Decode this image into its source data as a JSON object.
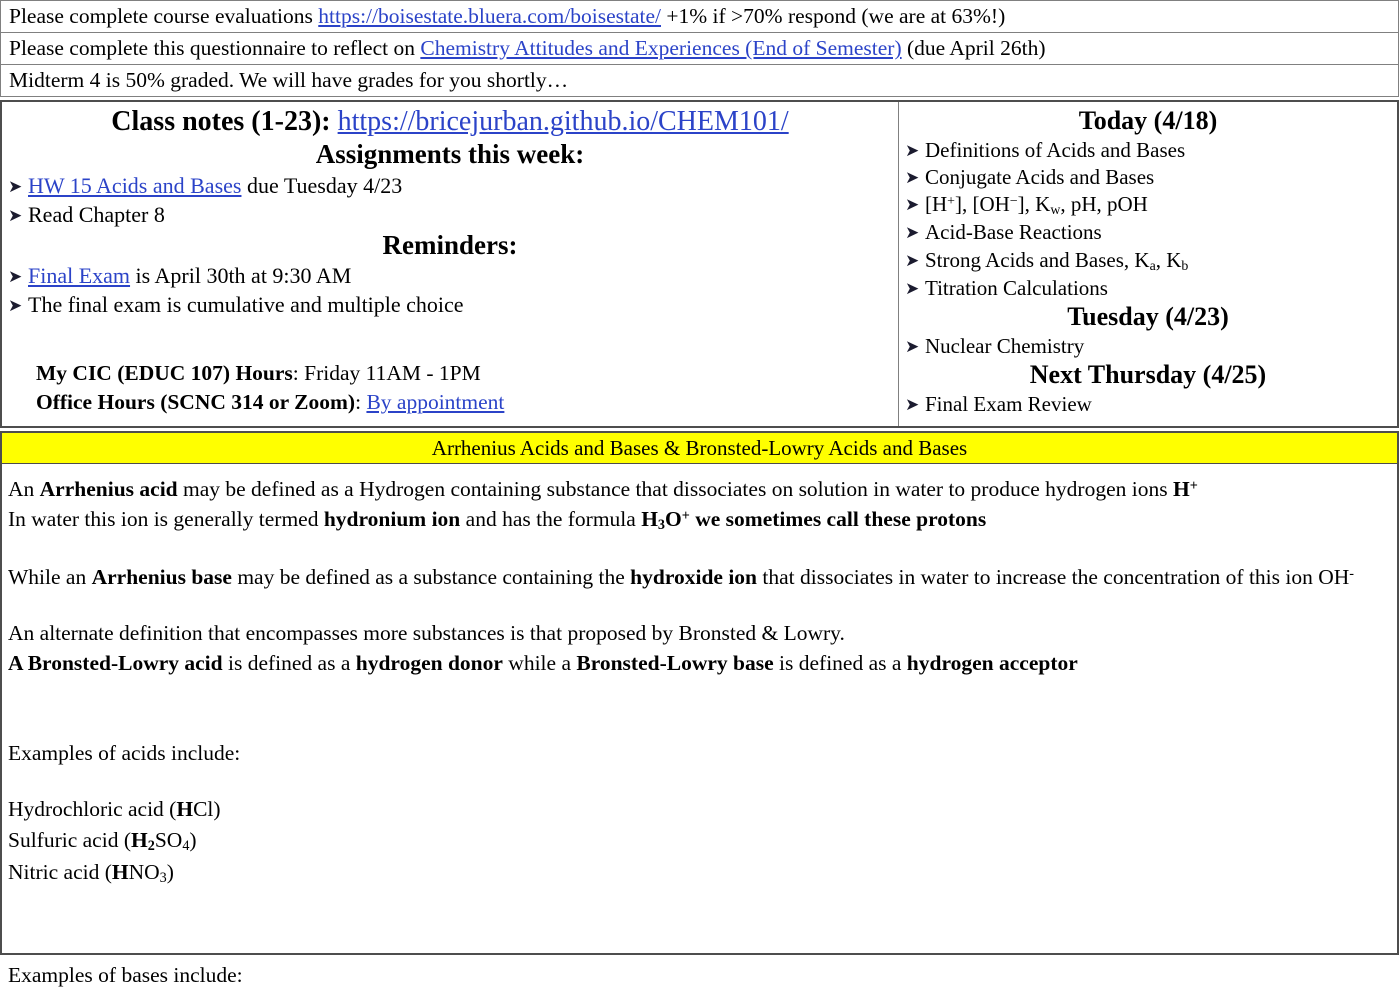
{
  "announcements": [
    {
      "pre": "Please complete course evaluations ",
      "link": "https://boisestate.bluera.com/boisestate/",
      "post": " +1% if >70% respond (we are at 63%!)"
    },
    {
      "pre": "Please complete this questionnaire to reflect on ",
      "link": "Chemistry Attitudes and Experiences (End of Semester)",
      "post": " (due April 26th)"
    },
    {
      "pre": "Midterm 4 is 50% graded. We will have grades for you shortly…",
      "link": "",
      "post": ""
    }
  ],
  "board": {
    "class_notes_label": "Class notes (1-23):",
    "class_notes_url": "https://bricejurban.github.io/CHEM101/",
    "assignments_header": "Assignments this week:",
    "assignments": [
      {
        "link": "HW 15 Acids and Bases",
        "text": " due Tuesday 4/23"
      },
      {
        "link": "",
        "text": "Read Chapter 8"
      }
    ],
    "reminders_header": "Reminders:",
    "reminders": [
      {
        "link": "Final Exam",
        "text": " is April 30th at 9:30 AM"
      },
      {
        "link": "",
        "text": "The final exam is cumulative and multiple choice"
      }
    ],
    "cic_label": "My CIC (EDUC 107) Hours",
    "cic_value": ": Friday 11AM - 1PM",
    "office_label": "Office Hours (SCNC 314 or Zoom)",
    "office_sep": ": ",
    "office_link": "By appointment"
  },
  "agenda": {
    "today_header": "Today (4/18)",
    "today_items": [
      "Definitions of Acids and Bases",
      "Conjugate Acids and Bases",
      "[H+], [OH−], Kw, pH, pOH",
      "Acid-Base Reactions",
      "Strong Acids and Bases, Ka, Kb",
      "Titration Calculations"
    ],
    "tuesday_header": "Tuesday (4/23)",
    "tuesday_items": [
      "Nuclear Chemistry"
    ],
    "thursday_header": "Next Thursday (4/25)",
    "thursday_items": [
      "Final Exam Review"
    ]
  },
  "slide": {
    "banner_title": "Arrhenius Acids and Bases & Bronsted-Lowry Acids and Bases",
    "line1_a": "An ",
    "line1_b": "Arrhenius acid",
    "line1_c": " may be defined as a Hydrogen containing substance that dissociates on solution in water to produce hydrogen ions ",
    "line1_d": "H+",
    "line2_a": "In water this ion is generally termed ",
    "line2_b": "hydronium ion",
    "line2_c": " and has the formula ",
    "line2_d": "H3O+ we sometimes call these protons",
    "line3_a": "While an ",
    "line3_b": "Arrhenius base",
    "line3_c": " may be defined as a substance containing the ",
    "line3_d": "hydroxide ion",
    "line3_e": " that dissociates in water to increase the concentration of this ion OH-",
    "line4": "An alternate definition that encompasses more substances is that proposed by Bronsted & Lowry.",
    "line5_a": "A Bronsted-Lowry acid",
    "line5_b": " is defined as a ",
    "line5_c": "hydrogen donor",
    "line5_d": " while a ",
    "line5_e": "Bronsted-Lowry base",
    "line5_f": " is defined as a ",
    "line5_g": "hydrogen acceptor",
    "acids_header": "Examples of acids include:",
    "acids": [
      {
        "name": "Hydrochloric acid (",
        "bold": "H",
        "rest": "Cl)"
      },
      {
        "name": "Sulfuric acid (",
        "bold": "H2",
        "rest": "SO4)"
      },
      {
        "name": "Nitric acid (",
        "bold": "H",
        "rest": "NO3)"
      }
    ],
    "bases_header": "Examples of bases include:"
  },
  "colors": {
    "link": "#2b43c8",
    "banner_bg": "#ffff00",
    "border": "#4d4d4d"
  }
}
